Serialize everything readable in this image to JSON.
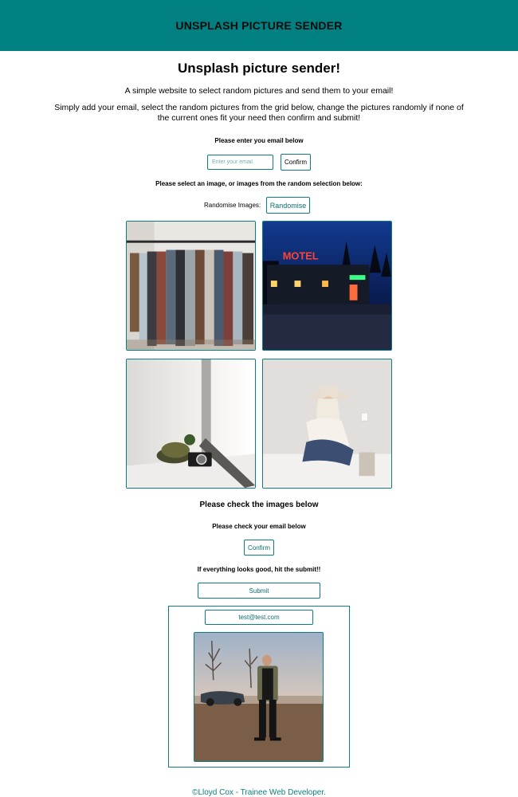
{
  "header": {
    "title": "UNSPLASH PICTURE SENDER"
  },
  "intro": {
    "heading": "Unsplash picture sender!",
    "line1": "A simple website to select random pictures and send them to your email!",
    "line2": "Simply add your email, select the random pictures from the grid below, change the pictures randomly if none of the current ones fit your need then confirm and submit!"
  },
  "email_form": {
    "label": "Please enter you email below",
    "placeholder": "Enter your email",
    "confirm_label": "Confirm"
  },
  "selection": {
    "label": "Please select an image, or images from the random selection below:",
    "randomise_label": "Randomise Images:",
    "randomise_button": "Randomise",
    "images": [
      {
        "icon": "clothes-rack-photo"
      },
      {
        "icon": "motel-night-photo"
      },
      {
        "icon": "turtle-camera-photo"
      },
      {
        "icon": "woman-hat-photo"
      }
    ]
  },
  "check": {
    "heading": "Please check the images below",
    "email_label": "Please check your email below",
    "confirm_label": "Confirm",
    "submit_prompt": "If everything looks good, hit the submit!!",
    "submit_label": "Submit"
  },
  "preview": {
    "email": "test@test.com",
    "image_icon": "man-with-car-photo"
  },
  "footer": {
    "text": "©Lloyd Cox - Trainee Web Developer."
  },
  "colors": {
    "accent": "#008080",
    "border": "#0c7d80"
  }
}
